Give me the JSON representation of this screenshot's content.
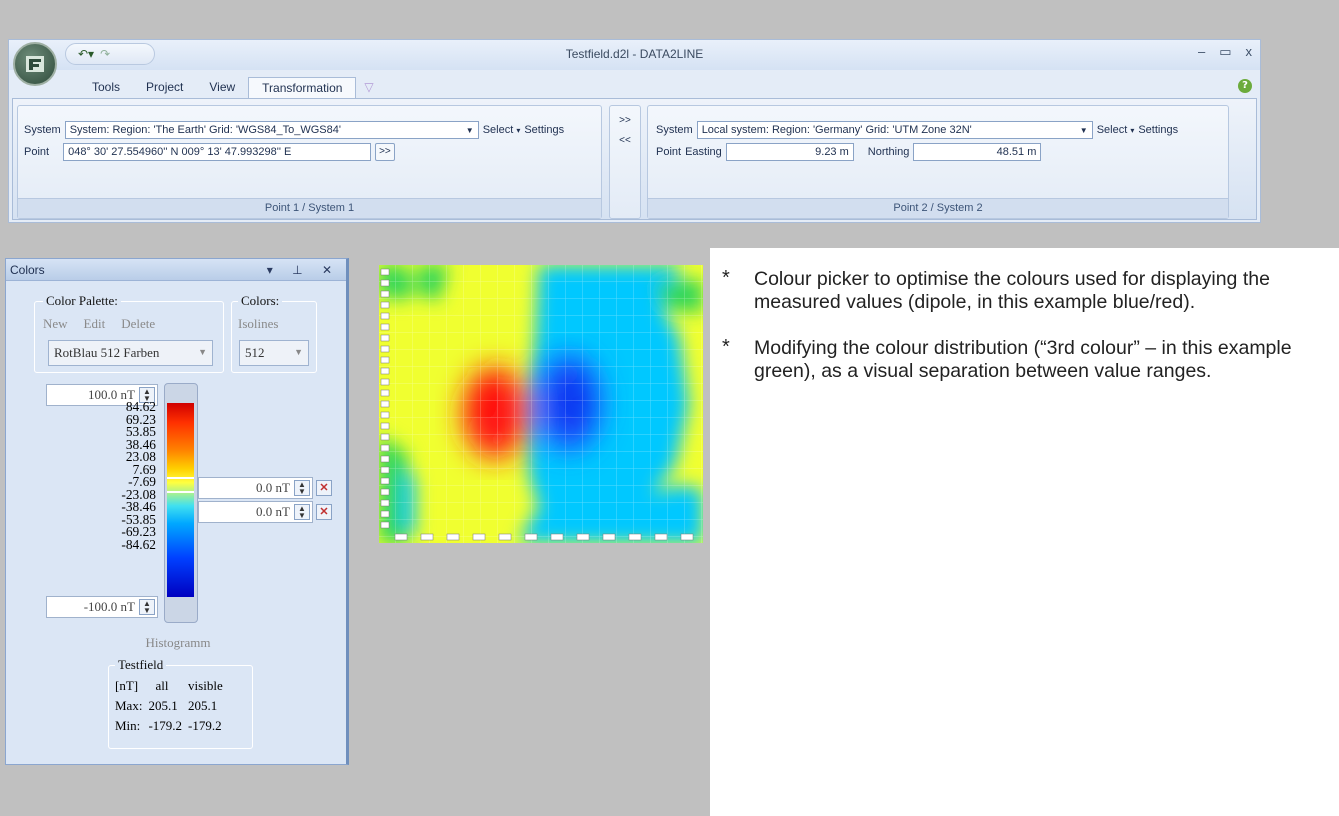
{
  "app": {
    "title": "Testfield.d2l - DATA2LINE",
    "tabs": [
      "Tools",
      "Project",
      "View",
      "Transformation"
    ],
    "window_buttons": [
      "–",
      "▭",
      "x"
    ]
  },
  "ribbon": {
    "group1": {
      "caption": "Point 1 / System 1",
      "system_label": "System",
      "system_value": "System: Region: 'The Earth'   Grid: 'WGS84_To_WGS84'",
      "select_label": "Select",
      "settings_label": "Settings",
      "point_label": "Point",
      "point_value": "048° 30' 27.554960'' N 009° 13' 47.993298'' E",
      "go_button": ">>"
    },
    "transfer": {
      "forward": ">>",
      "back": "<<"
    },
    "group2": {
      "caption": "Point 2 / System 2",
      "system_label": "System",
      "system_value": "Local system: Region: 'Germany'   Grid: 'UTM Zone 32N'",
      "select_label": "Select",
      "settings_label": "Settings",
      "point_label": "Point",
      "easting_label": "Easting",
      "easting_value": "9.23 m",
      "northing_label": "Northing",
      "northing_value": "48.51 m"
    }
  },
  "colors_panel": {
    "title": "Colors",
    "buttons": "▾ ⊥ ✕",
    "palette_legend": "Color Palette:",
    "colors_legend": "Colors:",
    "palette_actions": [
      "New",
      "Edit",
      "Delete"
    ],
    "isolines_label": "Isolines",
    "palette_value": "RotBlau 512 Farben",
    "colors_value": "512",
    "max_value": "100.0 nT",
    "min_value": "-100.0 nT",
    "third_color_upper": "0.0 nT",
    "third_color_lower": "0.0 nT",
    "ticks": [
      "84.62",
      "69.23",
      "53.85",
      "38.46",
      "23.08",
      "7.69",
      "-7.69",
      "-23.08",
      "-38.46",
      "-53.85",
      "-69.23",
      "-84.62"
    ],
    "histogram_label": "Histogramm",
    "stats": {
      "legend": "Testfield",
      "headers": [
        "[nT]",
        "all",
        "visible"
      ],
      "max_label": "Max:",
      "max_all": "205.1",
      "max_visible": "205.1",
      "min_label": "Min:",
      "min_all": "-179.2",
      "min_visible": "-179.2"
    }
  },
  "notes": [
    "Colour picker to optimise the colours used for displaying the measured values (dipole, in this example blue/red).",
    "Modifying the colour distribution (“3rd colour” – in this example green), as a visual separation between value ranges."
  ],
  "bullet_symbol": "*",
  "colors": {
    "background": "#c0c0c0",
    "heat_yellow": "#f0ff30",
    "heat_green": "#2ed65a",
    "heat_cyan": "#00c8ff",
    "heat_red": "#ff2020",
    "heat_blue": "#1a50ff"
  }
}
